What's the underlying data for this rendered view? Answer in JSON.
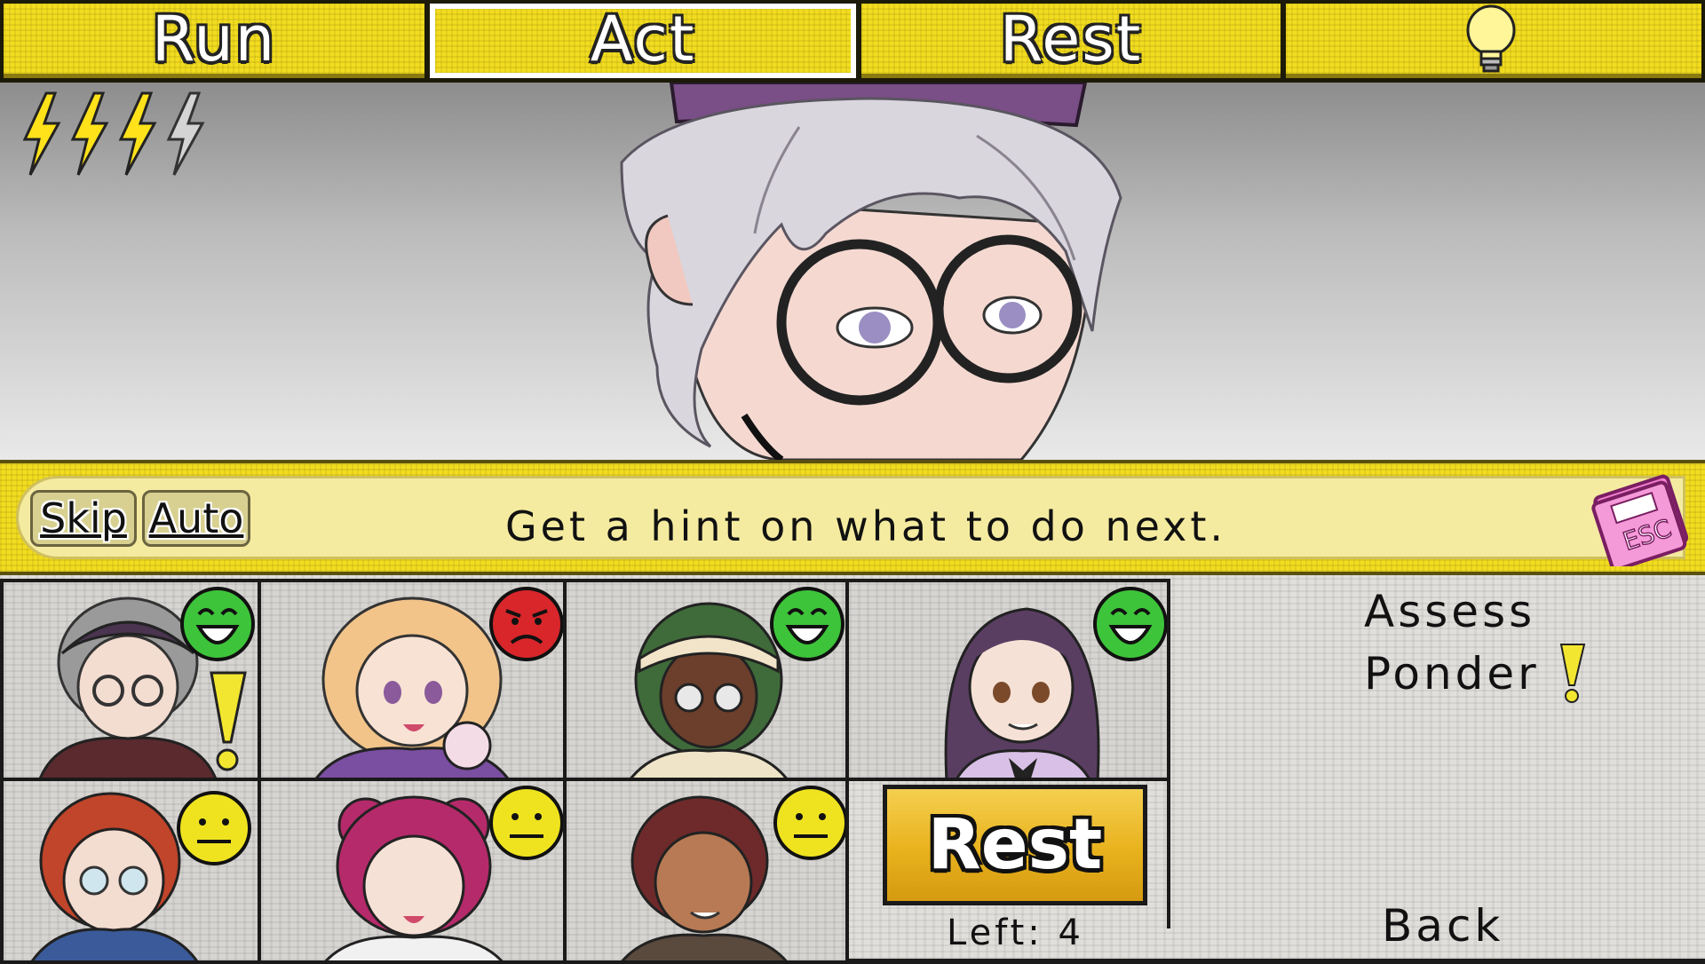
{
  "tabs": [
    {
      "label": "Run",
      "active": false
    },
    {
      "label": "Act",
      "active": true
    },
    {
      "label": "Rest",
      "active": false
    }
  ],
  "hint_icon": "lightbulb-icon",
  "energy": {
    "current": 3,
    "max": 4,
    "icon": "lightning-bolt-icon"
  },
  "scene": {
    "character": "silver-haired character with round glasses and purple beret"
  },
  "dialogue": {
    "skip_label": "Skip",
    "auto_label": "Auto",
    "text": "Get a hint on what to do next.",
    "menu_icon": "esc-notebook-icon"
  },
  "party": [
    {
      "hair": "#9a9a9a",
      "skin": "#f3dcd0",
      "mood": "happy",
      "has_alert": true
    },
    {
      "hair": "#f2c48a",
      "skin": "#f8e2d4",
      "mood": "upset",
      "has_alert": false
    },
    {
      "hair": "#3f6b3a",
      "skin": "#6b3f2c",
      "mood": "happy",
      "has_alert": false
    },
    {
      "hair": "#5a3e62",
      "skin": "#f6e1d6",
      "mood": "happy",
      "has_alert": false
    },
    {
      "hair": "#c0452a",
      "skin": "#f3dcd0",
      "mood": "neutral",
      "has_alert": false
    },
    {
      "hair": "#b52a6a",
      "skin": "#f6e1d6",
      "mood": "neutral",
      "has_alert": false
    },
    {
      "hair": "#6e2a2a",
      "skin": "#b77a55",
      "mood": "neutral",
      "has_alert": false
    }
  ],
  "mood_colors": {
    "happy": "#3ec43a",
    "upset": "#d8262a",
    "neutral": "#efe320"
  },
  "rest": {
    "label": "Rest",
    "left_text": "Left: 4"
  },
  "menu": {
    "assess": "Assess",
    "ponder": "Ponder",
    "back": "Back"
  }
}
